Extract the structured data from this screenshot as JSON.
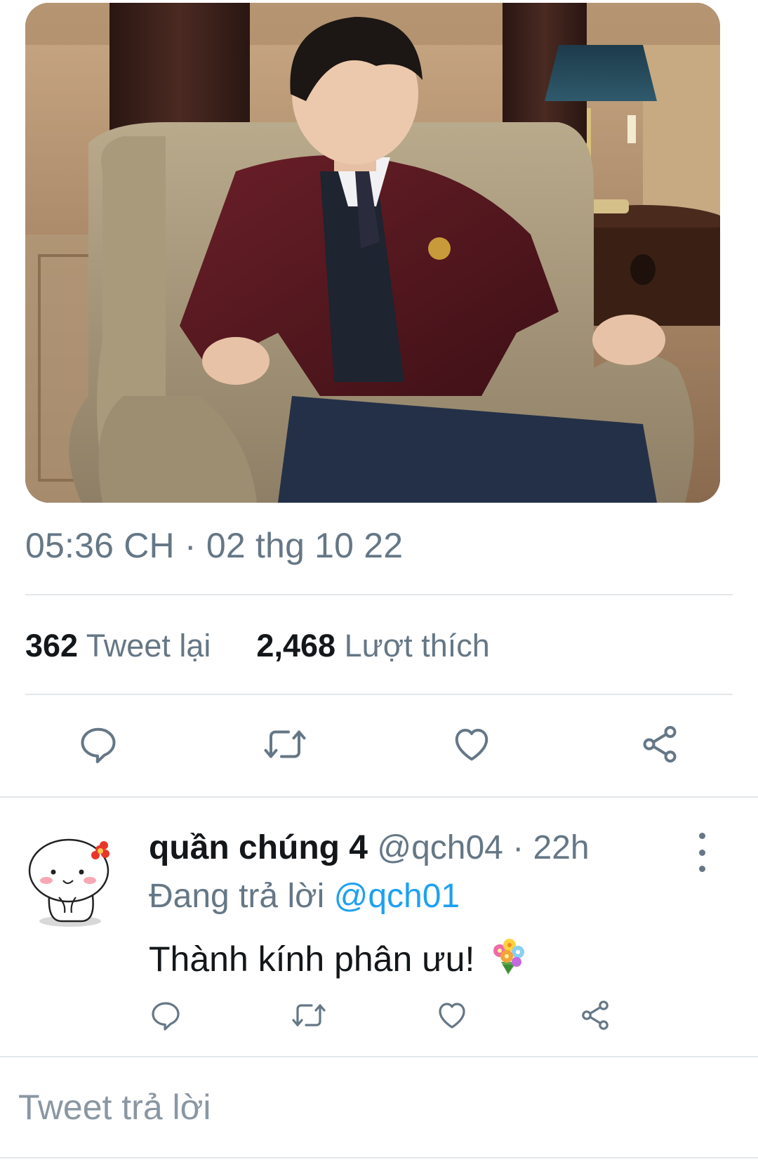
{
  "tweet": {
    "timestamp": "05:36 CH · 02 thg 10 22",
    "retweet_count": "362",
    "retweet_label": "Tweet lại",
    "like_count": "2,468",
    "like_label": "Lượt thích",
    "actions": [
      "reply-icon",
      "retweet-icon",
      "like-icon",
      "share-icon"
    ]
  },
  "reply": {
    "display_name": "quần chúng 4",
    "handle_time": "@qch04 · 22h",
    "replying_prefix": "Đang trả lời",
    "replying_to": "@qch01",
    "text": "Thành kính phân ưu!",
    "emoji": "bouquet-icon",
    "actions": [
      "reply-icon",
      "retweet-icon",
      "like-icon",
      "share-icon"
    ]
  },
  "composer": {
    "placeholder": "Tweet trả lời"
  },
  "colors": {
    "secondary_text": "#657786",
    "link": "#1da1f2",
    "divider": "#e3e7ea"
  }
}
